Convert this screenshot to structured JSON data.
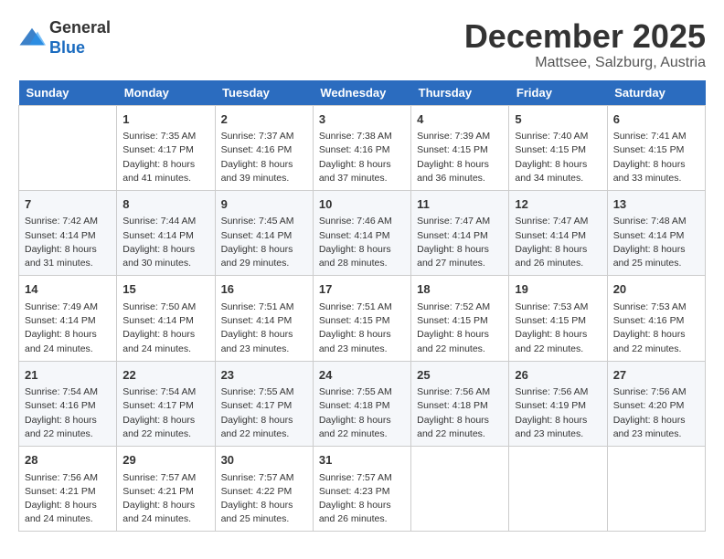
{
  "header": {
    "logo": {
      "general": "General",
      "blue": "Blue"
    },
    "month": "December 2025",
    "location": "Mattsee, Salzburg, Austria"
  },
  "days_of_week": [
    "Sunday",
    "Monday",
    "Tuesday",
    "Wednesday",
    "Thursday",
    "Friday",
    "Saturday"
  ],
  "weeks": [
    [
      {
        "day": "",
        "info": ""
      },
      {
        "day": "1",
        "info": "Sunrise: 7:35 AM\nSunset: 4:17 PM\nDaylight: 8 hours\nand 41 minutes."
      },
      {
        "day": "2",
        "info": "Sunrise: 7:37 AM\nSunset: 4:16 PM\nDaylight: 8 hours\nand 39 minutes."
      },
      {
        "day": "3",
        "info": "Sunrise: 7:38 AM\nSunset: 4:16 PM\nDaylight: 8 hours\nand 37 minutes."
      },
      {
        "day": "4",
        "info": "Sunrise: 7:39 AM\nSunset: 4:15 PM\nDaylight: 8 hours\nand 36 minutes."
      },
      {
        "day": "5",
        "info": "Sunrise: 7:40 AM\nSunset: 4:15 PM\nDaylight: 8 hours\nand 34 minutes."
      },
      {
        "day": "6",
        "info": "Sunrise: 7:41 AM\nSunset: 4:15 PM\nDaylight: 8 hours\nand 33 minutes."
      }
    ],
    [
      {
        "day": "7",
        "info": "Sunrise: 7:42 AM\nSunset: 4:14 PM\nDaylight: 8 hours\nand 31 minutes."
      },
      {
        "day": "8",
        "info": "Sunrise: 7:44 AM\nSunset: 4:14 PM\nDaylight: 8 hours\nand 30 minutes."
      },
      {
        "day": "9",
        "info": "Sunrise: 7:45 AM\nSunset: 4:14 PM\nDaylight: 8 hours\nand 29 minutes."
      },
      {
        "day": "10",
        "info": "Sunrise: 7:46 AM\nSunset: 4:14 PM\nDaylight: 8 hours\nand 28 minutes."
      },
      {
        "day": "11",
        "info": "Sunrise: 7:47 AM\nSunset: 4:14 PM\nDaylight: 8 hours\nand 27 minutes."
      },
      {
        "day": "12",
        "info": "Sunrise: 7:47 AM\nSunset: 4:14 PM\nDaylight: 8 hours\nand 26 minutes."
      },
      {
        "day": "13",
        "info": "Sunrise: 7:48 AM\nSunset: 4:14 PM\nDaylight: 8 hours\nand 25 minutes."
      }
    ],
    [
      {
        "day": "14",
        "info": "Sunrise: 7:49 AM\nSunset: 4:14 PM\nDaylight: 8 hours\nand 24 minutes."
      },
      {
        "day": "15",
        "info": "Sunrise: 7:50 AM\nSunset: 4:14 PM\nDaylight: 8 hours\nand 24 minutes."
      },
      {
        "day": "16",
        "info": "Sunrise: 7:51 AM\nSunset: 4:14 PM\nDaylight: 8 hours\nand 23 minutes."
      },
      {
        "day": "17",
        "info": "Sunrise: 7:51 AM\nSunset: 4:15 PM\nDaylight: 8 hours\nand 23 minutes."
      },
      {
        "day": "18",
        "info": "Sunrise: 7:52 AM\nSunset: 4:15 PM\nDaylight: 8 hours\nand 22 minutes."
      },
      {
        "day": "19",
        "info": "Sunrise: 7:53 AM\nSunset: 4:15 PM\nDaylight: 8 hours\nand 22 minutes."
      },
      {
        "day": "20",
        "info": "Sunrise: 7:53 AM\nSunset: 4:16 PM\nDaylight: 8 hours\nand 22 minutes."
      }
    ],
    [
      {
        "day": "21",
        "info": "Sunrise: 7:54 AM\nSunset: 4:16 PM\nDaylight: 8 hours\nand 22 minutes."
      },
      {
        "day": "22",
        "info": "Sunrise: 7:54 AM\nSunset: 4:17 PM\nDaylight: 8 hours\nand 22 minutes."
      },
      {
        "day": "23",
        "info": "Sunrise: 7:55 AM\nSunset: 4:17 PM\nDaylight: 8 hours\nand 22 minutes."
      },
      {
        "day": "24",
        "info": "Sunrise: 7:55 AM\nSunset: 4:18 PM\nDaylight: 8 hours\nand 22 minutes."
      },
      {
        "day": "25",
        "info": "Sunrise: 7:56 AM\nSunset: 4:18 PM\nDaylight: 8 hours\nand 22 minutes."
      },
      {
        "day": "26",
        "info": "Sunrise: 7:56 AM\nSunset: 4:19 PM\nDaylight: 8 hours\nand 23 minutes."
      },
      {
        "day": "27",
        "info": "Sunrise: 7:56 AM\nSunset: 4:20 PM\nDaylight: 8 hours\nand 23 minutes."
      }
    ],
    [
      {
        "day": "28",
        "info": "Sunrise: 7:56 AM\nSunset: 4:21 PM\nDaylight: 8 hours\nand 24 minutes."
      },
      {
        "day": "29",
        "info": "Sunrise: 7:57 AM\nSunset: 4:21 PM\nDaylight: 8 hours\nand 24 minutes."
      },
      {
        "day": "30",
        "info": "Sunrise: 7:57 AM\nSunset: 4:22 PM\nDaylight: 8 hours\nand 25 minutes."
      },
      {
        "day": "31",
        "info": "Sunrise: 7:57 AM\nSunset: 4:23 PM\nDaylight: 8 hours\nand 26 minutes."
      },
      {
        "day": "",
        "info": ""
      },
      {
        "day": "",
        "info": ""
      },
      {
        "day": "",
        "info": ""
      }
    ]
  ]
}
